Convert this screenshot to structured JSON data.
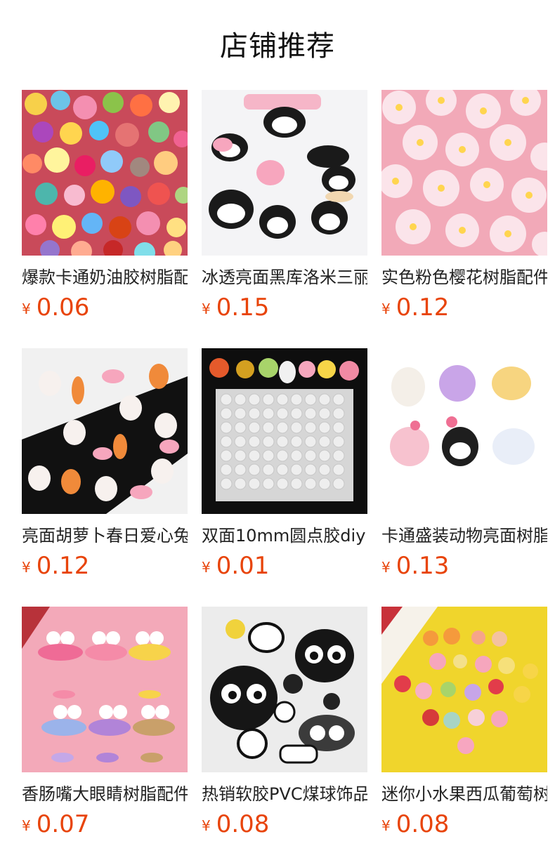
{
  "header": {
    "title": "店铺推荐"
  },
  "currency_symbol": "¥",
  "products": [
    {
      "name": "爆款卡通奶油胶树脂配件",
      "price": "0.06",
      "image": "colorful-mixed-resin-charms"
    },
    {
      "name": "冰透亮面黑库洛米三丽鸥",
      "price": "0.15",
      "image": "kuromi-resin-charms"
    },
    {
      "name": "实色粉色樱花树脂配件",
      "price": "0.12",
      "image": "pink-sakura-flowers"
    },
    {
      "name": "亮面胡萝卜春日爱心兔子",
      "price": "0.12",
      "image": "bunny-carrot-charms"
    },
    {
      "name": "双面10mm圆点胶diy",
      "price": "0.01",
      "image": "glue-dot-sheet"
    },
    {
      "name": "卡通盛装动物亮面树脂",
      "price": "0.13",
      "image": "dressed-cartoon-animals"
    },
    {
      "name": "香肠嘴大眼睛树脂配件",
      "price": "0.07",
      "image": "sausage-mouth-big-eyes"
    },
    {
      "name": "热销软胶PVC煤球饰品",
      "price": "0.08",
      "image": "soot-sprite-pvc"
    },
    {
      "name": "迷你小水果西瓜葡萄树脂",
      "price": "0.08",
      "image": "mini-fruit-charms"
    }
  ]
}
